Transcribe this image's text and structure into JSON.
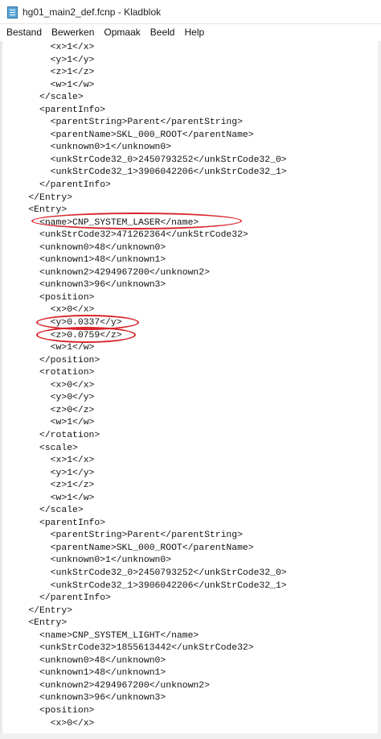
{
  "window": {
    "title": "hg01_main2_def.fcnp - Kladblok",
    "icon": "notepad-icon"
  },
  "menu": {
    "items": [
      "Bestand",
      "Bewerken",
      "Opmaak",
      "Beeld",
      "Help"
    ]
  },
  "editor": {
    "lines": [
      "        <x>1</x>",
      "        <y>1</y>",
      "        <z>1</z>",
      "        <w>1</w>",
      "      </scale>",
      "      <parentInfo>",
      "        <parentString>Parent</parentString>",
      "        <parentName>SKL_000_ROOT</parentName>",
      "        <unknown0>1</unknown0>",
      "        <unkStrCode32_0>2450793252</unkStrCode32_0>",
      "        <unkStrCode32_1>3906042206</unkStrCode32_1>",
      "      </parentInfo>",
      "    </Entry>",
      "    <Entry>",
      "      <name>CNP_SYSTEM_LASER</name>",
      "      <unkStrCode32>471262364</unkStrCode32>",
      "      <unknown0>48</unknown0>",
      "      <unknown1>48</unknown1>",
      "      <unknown2>4294967200</unknown2>",
      "      <unknown3>96</unknown3>",
      "      <position>",
      "        <x>0</x>",
      "        <y>0.0337</y>",
      "        <z>0.0759</z>",
      "        <w>1</w>",
      "      </position>",
      "      <rotation>",
      "        <x>0</x>",
      "        <y>0</y>",
      "        <z>0</z>",
      "        <w>1</w>",
      "      </rotation>",
      "      <scale>",
      "        <x>1</x>",
      "        <y>1</y>",
      "        <z>1</z>",
      "        <w>1</w>",
      "      </scale>",
      "      <parentInfo>",
      "        <parentString>Parent</parentString>",
      "        <parentName>SKL_000_ROOT</parentName>",
      "        <unknown0>1</unknown0>",
      "        <unkStrCode32_0>2450793252</unkStrCode32_0>",
      "        <unkStrCode32_1>3906042206</unkStrCode32_1>",
      "      </parentInfo>",
      "    </Entry>",
      "    <Entry>",
      "      <name>CNP_SYSTEM_LIGHT</name>",
      "      <unkStrCode32>1855613442</unkStrCode32>",
      "      <unknown0>48</unknown0>",
      "      <unknown1>48</unknown1>",
      "      <unknown2>4294967200</unknown2>",
      "      <unknown3>96</unknown3>",
      "      <position>",
      "        <x>0</x>"
    ]
  },
  "annotations": {
    "color": "#d8242b",
    "highlighted_lines": [
      14,
      22,
      23
    ]
  }
}
